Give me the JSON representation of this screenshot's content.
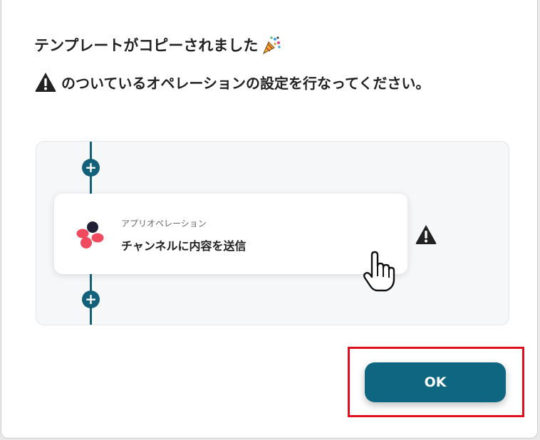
{
  "dialog": {
    "title": "テンプレートがコピーされました",
    "title_icon": "party-popper-icon",
    "subtitle": "のついているオペレーションの設定を行なってください。",
    "subtitle_icon": "warning-icon"
  },
  "flow": {
    "accent_color": "#12607a",
    "add_symbol": "+",
    "operation": {
      "kind_label": "アプリオペレーション",
      "name": "チャンネルに内容を送信",
      "app_icon": "app-logo-icon",
      "status_icon": "warning-icon"
    }
  },
  "footer": {
    "ok_label": "OK",
    "ok_color": "#0f6680",
    "highlight_color": "#e00f1f"
  }
}
